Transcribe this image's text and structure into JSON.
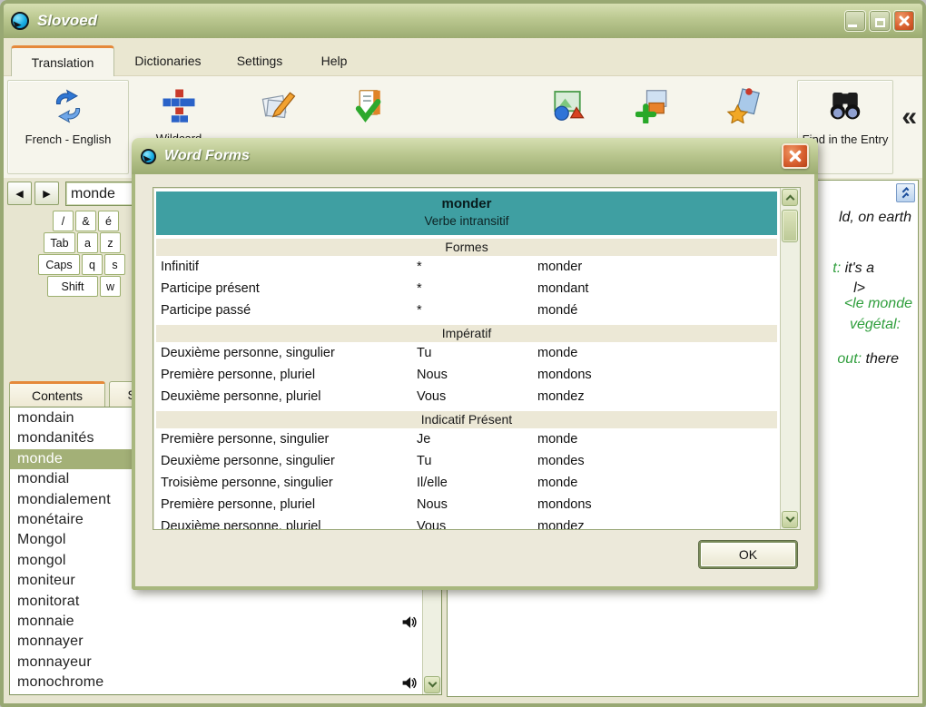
{
  "window": {
    "title": "Slovoed"
  },
  "menu_tabs": [
    {
      "label": "Translation",
      "active": true
    },
    {
      "label": "Dictionaries",
      "active": false
    },
    {
      "label": "Settings",
      "active": false
    },
    {
      "label": "Help",
      "active": false
    }
  ],
  "toolbar": {
    "items": [
      {
        "name": "translation-direction",
        "icon": "swap-languages-icon",
        "label": "French - English"
      },
      {
        "name": "wildcard-search",
        "icon": "wildcard-crossword-icon",
        "label": "Wildcard"
      },
      {
        "name": "edit-entry",
        "icon": "edit-card-icon",
        "label": ""
      },
      {
        "name": "check-document",
        "icon": "check-document-icon",
        "label": ""
      },
      {
        "name": "pictures",
        "icon": "pictures-icon",
        "label": ""
      },
      {
        "name": "add-card",
        "icon": "add-card-icon",
        "label": ""
      },
      {
        "name": "favorites",
        "icon": "favorites-card-icon",
        "label": ""
      },
      {
        "name": "find-in-entry",
        "icon": "binoculars-icon",
        "label": "Find in the Entry"
      }
    ],
    "overflow_glyph": "«"
  },
  "history": {
    "back_glyph": "◀",
    "forward_glyph": "▶"
  },
  "search": {
    "value": "monde"
  },
  "keyboard_rows": [
    [
      "/",
      "&",
      "é"
    ],
    [
      "Tab",
      "a",
      "z"
    ],
    [
      "Caps",
      "q",
      "s"
    ],
    [
      "Shift",
      "w"
    ]
  ],
  "list_tabs": [
    {
      "label": "Contents",
      "active": true
    },
    {
      "label": "Se",
      "active": false
    }
  ],
  "word_list": [
    {
      "text": "mondain"
    },
    {
      "text": "mondanités"
    },
    {
      "text": "monde",
      "selected": true
    },
    {
      "text": "mondial"
    },
    {
      "text": "mondialement"
    },
    {
      "text": "monétaire"
    },
    {
      "text": "Mongol"
    },
    {
      "text": "mongol"
    },
    {
      "text": "moniteur"
    },
    {
      "text": "monitorat"
    },
    {
      "text": "monnaie",
      "sound": true
    },
    {
      "text": "monnayer"
    },
    {
      "text": "monnayeur"
    },
    {
      "text": "monochrome",
      "sound": true
    }
  ],
  "entry_fragments": [
    {
      "green": "",
      "black": "ld, on earth"
    },
    {
      "green": "t:",
      "black": " it's a"
    },
    {
      "green": "",
      "black": "l>"
    },
    {
      "green": "<le monde",
      "black": ""
    },
    {
      "green": "végétal:",
      "black": ""
    },
    {
      "green": "out:",
      "black": " there"
    }
  ],
  "dialog": {
    "title": "Word Forms",
    "headword": "monder",
    "part_of_speech": "Verbe intransitif",
    "sections": [
      {
        "title": "Formes",
        "rows": [
          [
            "Infinitif",
            "*",
            "monder"
          ],
          [
            "Participe présent",
            "*",
            "mondant"
          ],
          [
            "Participe passé",
            "*",
            "mondé"
          ]
        ]
      },
      {
        "title": "Impératif",
        "rows": [
          [
            "Deuxième personne, singulier",
            "Tu",
            "monde"
          ],
          [
            "Première personne, pluriel",
            "Nous",
            "mondons"
          ],
          [
            "Deuxième personne, pluriel",
            "Vous",
            "mondez"
          ]
        ]
      },
      {
        "title": "Indicatif Présent",
        "rows": [
          [
            "Première personne, singulier",
            "Je",
            "monde"
          ],
          [
            "Deuxième personne, singulier",
            "Tu",
            "mondes"
          ],
          [
            "Troisième personne, singulier",
            "Il/elle",
            "monde"
          ],
          [
            "Première personne, pluriel",
            "Nous",
            "mondons"
          ],
          [
            "Deuxième personne, pluriel",
            "Vous",
            "mondez"
          ]
        ]
      }
    ],
    "ok_label": "OK"
  },
  "colors": {
    "titlebar_olive": "#bac78f",
    "teal_header": "#3f9fa2",
    "selection_olive": "#a3b077",
    "active_tab_accent": "#e5893a",
    "close_button_orange": "#d8602f",
    "example_green": "#2f9e3c"
  }
}
